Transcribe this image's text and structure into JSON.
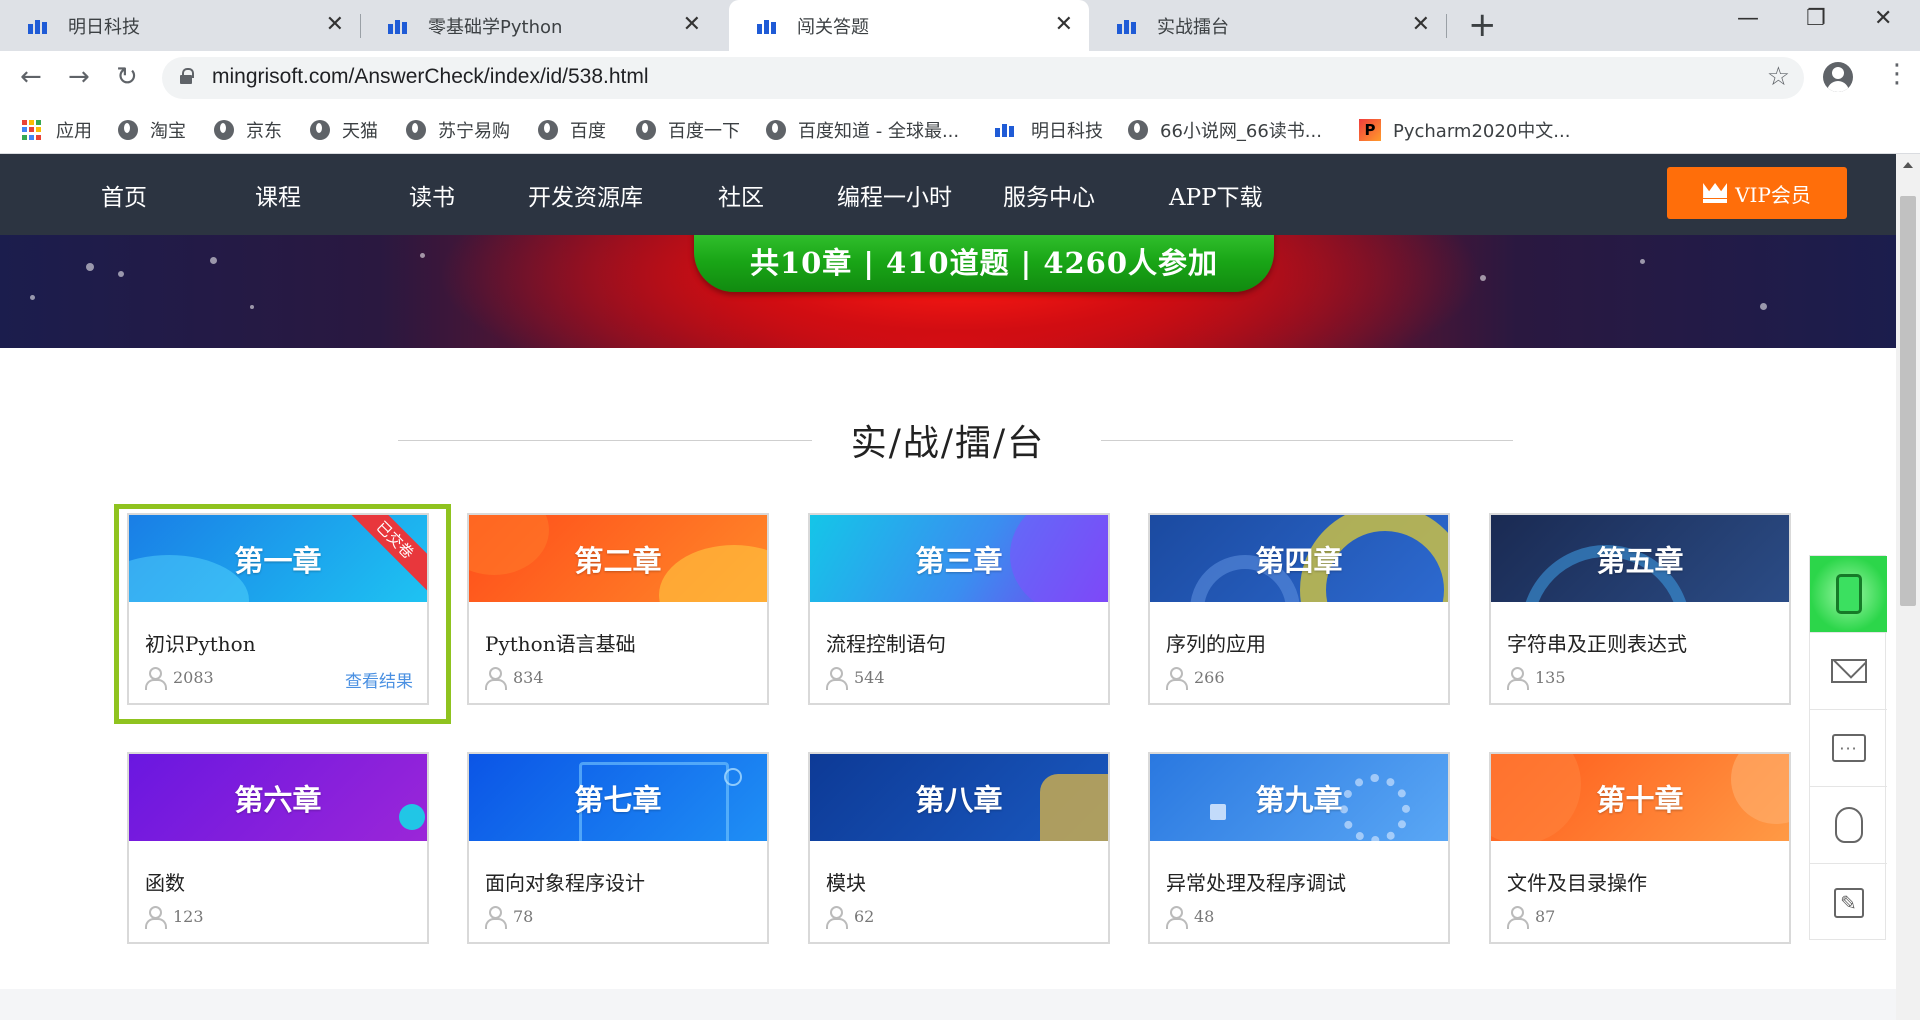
{
  "browser": {
    "tabs": [
      {
        "title": "明日科技",
        "active": false
      },
      {
        "title": "零基础学Python",
        "active": false
      },
      {
        "title": "闯关答题",
        "active": true
      },
      {
        "title": "实战擂台",
        "active": false
      }
    ],
    "new_tab": "+",
    "url": "mingrisoft.com/AnswerCheck/index/id/538.html",
    "bookmarks": [
      "应用",
      "淘宝",
      "京东",
      "天猫",
      "苏宁易购",
      "百度",
      "百度一下",
      "百度知道 - 全球最...",
      "明日科技",
      "66小说网_66读书...",
      "Pycharm2020中文..."
    ]
  },
  "site": {
    "nav": [
      "首页",
      "课程",
      "读书",
      "开发资源库",
      "社区",
      "编程一小时",
      "服务中心",
      "APP下载"
    ],
    "vip_label": "VIP会员",
    "banner_stats": "共10章 | 410道题 | 4260人参加",
    "section_title": "实/战/擂/台",
    "chapters": [
      {
        "chapter": "第一章",
        "title": "初识Python",
        "count": "2083",
        "badge": "已交卷",
        "link": "查看结果",
        "colors": [
          "#1e9bf0",
          "#1ac0f2"
        ]
      },
      {
        "chapter": "第二章",
        "title": "Python语言基础",
        "count": "834",
        "colors": [
          "#ff5a1f",
          "#ff9a2e"
        ]
      },
      {
        "chapter": "第三章",
        "title": "流程控制语句",
        "count": "544",
        "colors": [
          "#18c0e6",
          "#6e4cf0"
        ]
      },
      {
        "chapter": "第四章",
        "title": "序列的应用",
        "count": "266",
        "colors": [
          "#1c4fa8",
          "#2f6bd0"
        ]
      },
      {
        "chapter": "第五章",
        "title": "字符串及正则表达式",
        "count": "135",
        "colors": [
          "#1d2f5a",
          "#2a4f8c"
        ]
      },
      {
        "chapter": "第六章",
        "title": "函数",
        "count": "123",
        "colors": [
          "#7a1be0",
          "#a32bd8"
        ]
      },
      {
        "chapter": "第七章",
        "title": "面向对象程序设计",
        "count": "78",
        "colors": [
          "#0d59e8",
          "#1f8cf5"
        ]
      },
      {
        "chapter": "第八章",
        "title": "模块",
        "count": "62",
        "colors": [
          "#0f3d9a",
          "#1a5bc2"
        ]
      },
      {
        "chapter": "第九章",
        "title": "异常处理及程序调试",
        "count": "48",
        "colors": [
          "#2b7ae0",
          "#5aa6f5"
        ]
      },
      {
        "chapter": "第十章",
        "title": "文件及目录操作",
        "count": "87",
        "colors": [
          "#ff6a1f",
          "#ff9540"
        ]
      }
    ],
    "accent": "#8fc31f",
    "vip_color": "#ff6e0a"
  }
}
